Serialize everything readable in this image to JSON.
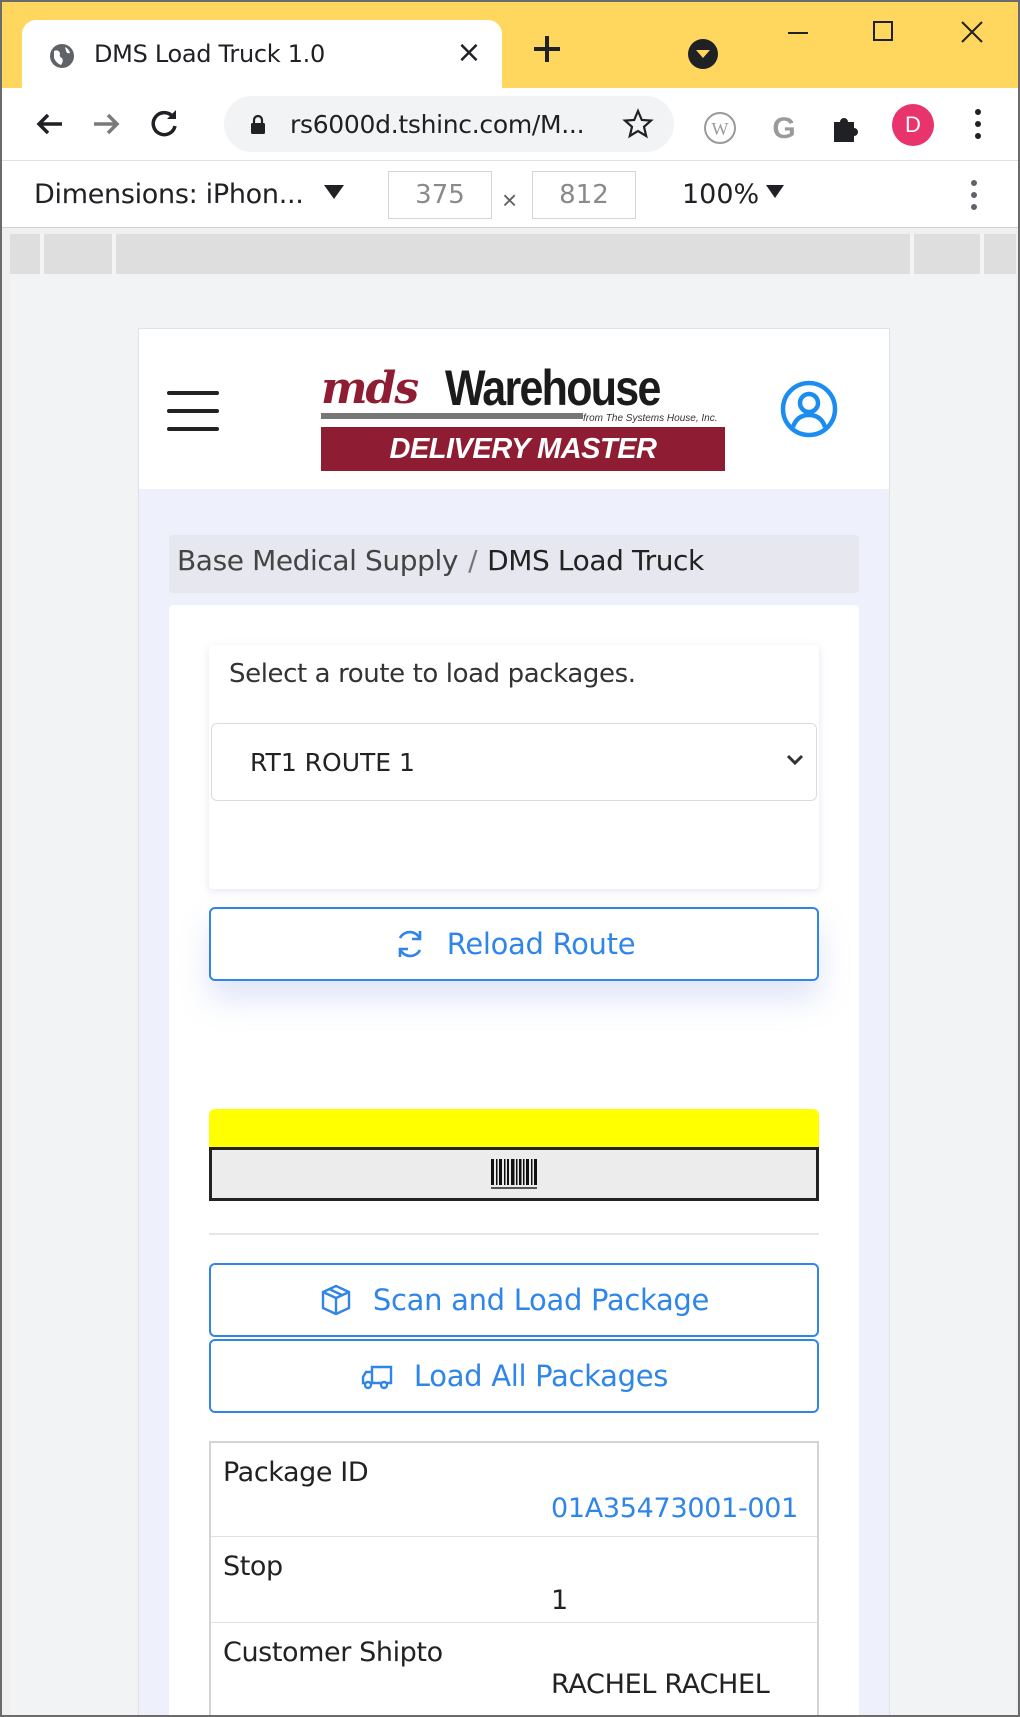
{
  "browser": {
    "tab_title": "DMS Load Truck 1.0",
    "url": "rs6000d.tshinc.com/M...",
    "profile_initial": "D"
  },
  "devtools": {
    "dimensions_label": "Dimensions: iPhon...",
    "width": "375",
    "height": "812",
    "times": "×",
    "zoom": "100%"
  },
  "logo": {
    "brand": "mds",
    "warehouse": "Warehouse",
    "tagline": "from The Systems House, Inc.",
    "banner": "DELIVERY MASTER"
  },
  "breadcrumb": {
    "parent": "Base Medical Supply",
    "separator": "/",
    "current": "DMS Load Truck"
  },
  "route": {
    "prompt": "Select a route to load packages.",
    "selected": "RT1 ROUTE 1"
  },
  "buttons": {
    "reload": "Reload Route",
    "scan": "Scan and Load Package",
    "load_all": "Load All Packages"
  },
  "package": {
    "rows": [
      {
        "label": "Package ID",
        "value": "01A35473001-001",
        "link": true
      },
      {
        "label": "Stop",
        "value": "1",
        "link": false
      },
      {
        "label": "Customer Shipto",
        "value": "RACHEL RACHEL",
        "link": false
      }
    ]
  },
  "colors": {
    "tabstrip": "#ffd75e",
    "brand": "#8e1d33",
    "accent": "#2f86e8",
    "scan_bar": "#ffff00"
  }
}
